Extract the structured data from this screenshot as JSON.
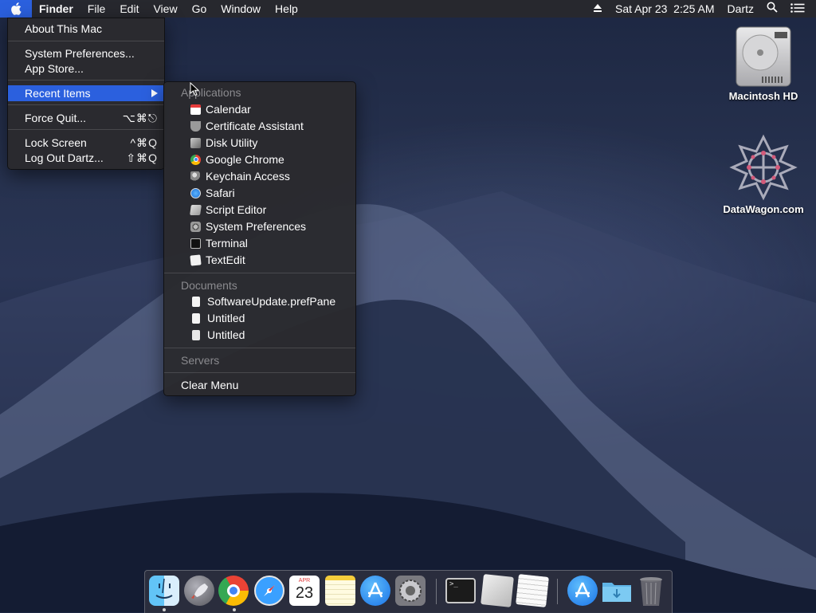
{
  "menubar": {
    "app": "Finder",
    "menus": [
      "File",
      "Edit",
      "View",
      "Go",
      "Window",
      "Help"
    ],
    "datetime": "Sat Apr 23  2:25 AM",
    "user": "Dartz"
  },
  "apple_menu": {
    "about": "About This Mac",
    "system_prefs": "System Preferences...",
    "app_store": "App Store...",
    "recent_items": "Recent Items",
    "force_quit": "Force Quit...",
    "force_quit_shortcut": "⌥⌘⎋",
    "lock_screen": "Lock Screen",
    "lock_screen_shortcut": "^⌘Q",
    "log_out": "Log Out Dartz...",
    "log_out_shortcut": "⇧⌘Q"
  },
  "recent_menu": {
    "applications_header": "Applications",
    "applications": [
      "Calendar",
      "Certificate Assistant",
      "Disk Utility",
      "Google Chrome",
      "Keychain Access",
      "Safari",
      "Script Editor",
      "System Preferences",
      "Terminal",
      "TextEdit"
    ],
    "documents_header": "Documents",
    "documents": [
      "SoftwareUpdate.prefPane",
      "Untitled",
      "Untitled"
    ],
    "servers_header": "Servers",
    "clear_menu": "Clear Menu"
  },
  "desktop": {
    "hd_label": "Macintosh HD",
    "web_label": "DataWagon.com"
  },
  "dock": {
    "calendar_month": "APR",
    "calendar_day": "23",
    "terminal_prompt": ">_"
  },
  "colors": {
    "highlight": "#2b60de",
    "menu_bg": "#2a2a2e"
  }
}
